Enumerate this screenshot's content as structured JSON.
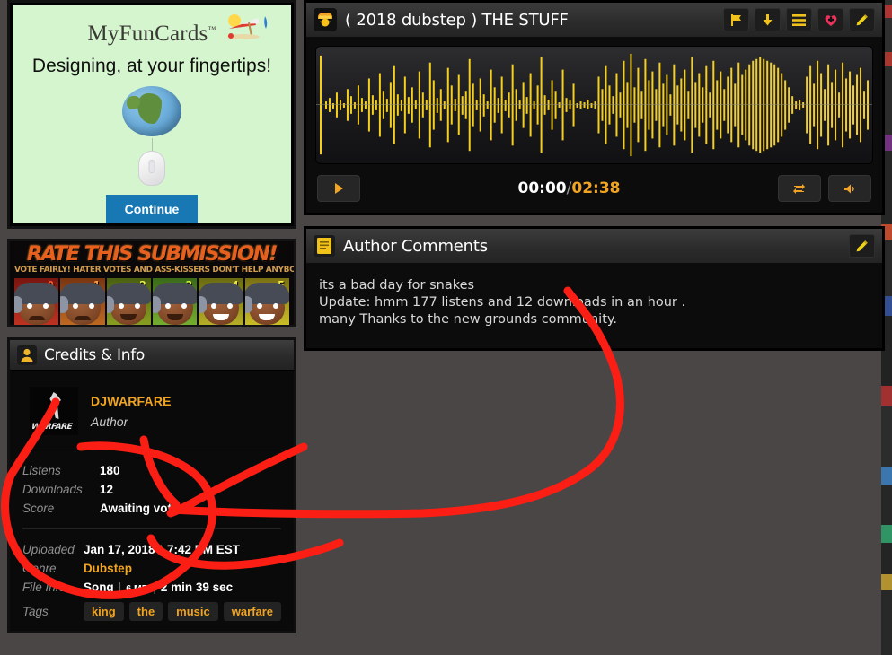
{
  "ad": {
    "brand": "MyFunCards",
    "trademark": "™",
    "tagline": "Designing, at your fingertips!",
    "button_label": "Continue"
  },
  "rate_box": {
    "title": "RATE THIS SUBMISSION!",
    "subtitle": "VOTE FAIRLY! HATER VOTES AND ASS-KISSERS DON'T HELP ANYBODY.",
    "faces": [
      {
        "number": "0",
        "number_color": "#e04b2a"
      },
      {
        "number": "1",
        "number_color": "#e8843a"
      },
      {
        "number": "2",
        "number_color": "#d8d84a"
      },
      {
        "number": "3",
        "number_color": "#cfe04a"
      },
      {
        "number": "4",
        "number_color": "#e8d84a"
      },
      {
        "number": "5",
        "number_color": "#f0e04a"
      }
    ]
  },
  "credits": {
    "header_title": "Credits & Info",
    "header_icon": "person-icon",
    "author_name": "DJWARFARE",
    "author_role": "Author",
    "author_thumb_text": "WARFARE",
    "stats": [
      {
        "key": "Listens",
        "value": "180"
      },
      {
        "key": "Downloads",
        "value": "12"
      },
      {
        "key": "Score",
        "value": "Awaiting votes"
      }
    ],
    "details": [
      {
        "key": "Uploaded",
        "value": "Jan 17, 2018",
        "value2": "7:42 PM EST",
        "gold": false
      },
      {
        "key": "Genre",
        "value": "Dubstep",
        "gold": true
      },
      {
        "key": "File Info",
        "value": "Song",
        "value2": "6 MB",
        "value3": "2 min 39 sec",
        "gold": false
      }
    ],
    "tags_label": "Tags",
    "tags": [
      "king",
      "the",
      "music",
      "warfare"
    ]
  },
  "player": {
    "title": "( 2018 dubstep ) THE STUFF",
    "title_icon": "audio-song-icon",
    "actions": [
      {
        "name": "flag-icon",
        "glyph": "⚑"
      },
      {
        "name": "download-icon",
        "glyph": "↓"
      },
      {
        "name": "playlist-menu-icon",
        "glyph": "☰"
      },
      {
        "name": "favorite-heart-icon",
        "glyph": "♥"
      },
      {
        "name": "edit-pencil-icon",
        "glyph": "✎"
      }
    ],
    "play_glyph": "▶",
    "current_time": "00:00",
    "time_separator": "/",
    "total_time": "02:38",
    "loop_glyph": "↻",
    "volume_glyph": "◂",
    "accent_color": "#f0a421",
    "wave_color": "#f5cf1e"
  },
  "comments": {
    "header_title": "Author Comments",
    "header_icon": "document-icon",
    "edit_icon": "edit-pencil-icon",
    "lines": [
      "its a bad day for snakes",
      "Update: hmm 177 listens and 12 downloads in an hour .",
      "many Thanks to the new grounds community."
    ]
  },
  "annotation": {
    "color": "#fb1e14",
    "stroke_width": 9,
    "description": "hand-drawn red circle around listens/downloads stats with arrow pointing to comments"
  }
}
